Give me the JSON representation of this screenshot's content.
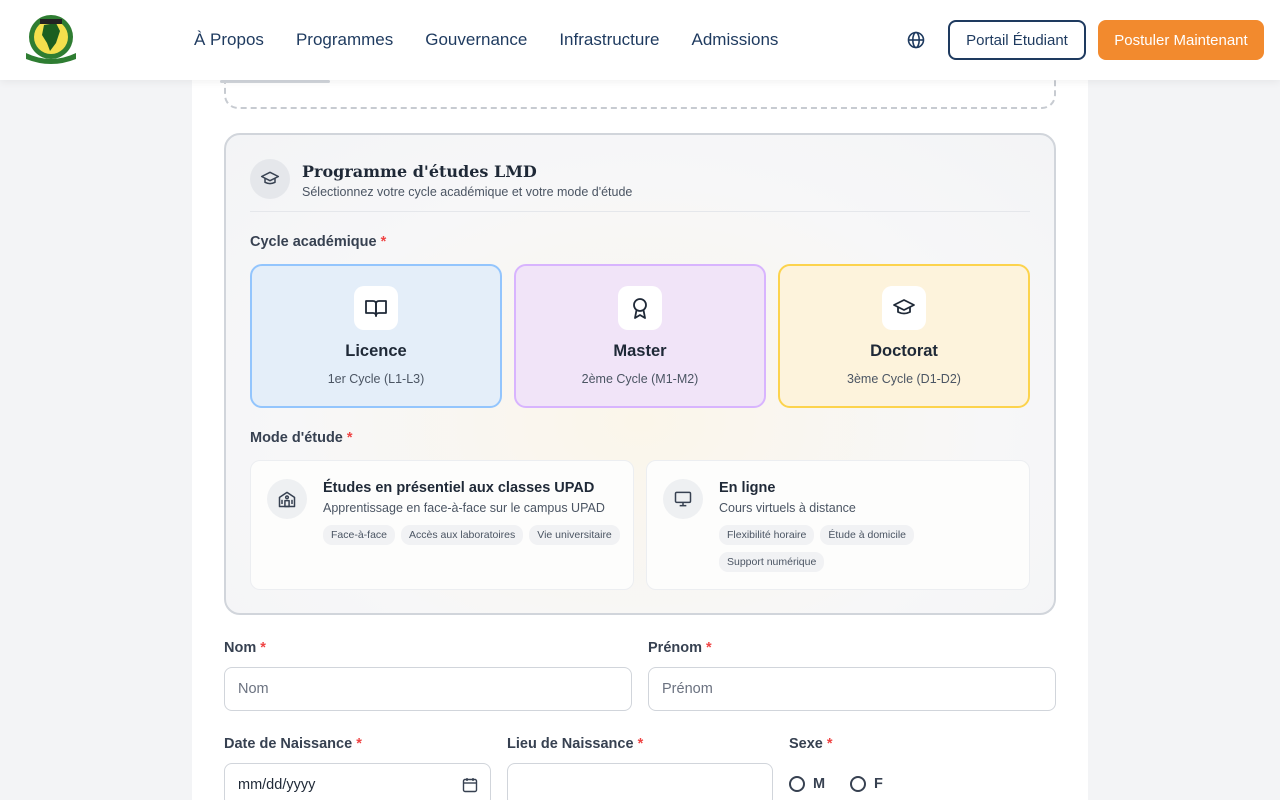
{
  "header": {
    "logo_alt": "UPAD",
    "nav": [
      "À Propos",
      "Programmes",
      "Gouvernance",
      "Infrastructure",
      "Admissions"
    ],
    "language_icon": "globe-icon",
    "portal_label": "Portail Étudiant",
    "apply_label": "Postuler Maintenant",
    "accent_color": "#f28a2e",
    "brand_color": "#1e3a5f"
  },
  "program": {
    "icon": "graduation-cap-icon",
    "title": "Programme d'études LMD",
    "subtitle": "Sélectionnez votre cycle académique et votre mode d'étude",
    "cycle_label": "Cycle académique",
    "required_mark": "*",
    "cycles": [
      {
        "name": "Licence",
        "detail": "1er Cycle (L1-L3)",
        "icon": "book-open-icon"
      },
      {
        "name": "Master",
        "detail": "2ème Cycle (M1-M2)",
        "icon": "award-icon"
      },
      {
        "name": "Doctorat",
        "detail": "3ème Cycle (D1-D2)",
        "icon": "graduation-cap-icon"
      }
    ],
    "mode_label": "Mode d'étude",
    "modes": [
      {
        "name": "Études en présentiel aux classes UPAD",
        "detail": "Apprentissage en face-à-face sur le campus UPAD",
        "icon": "school-building-icon",
        "tags": [
          "Face-à-face",
          "Accès aux laboratoires",
          "Vie universitaire"
        ]
      },
      {
        "name": "En ligne",
        "detail": "Cours virtuels à distance",
        "icon": "monitor-icon",
        "tags": [
          "Flexibilité horaire",
          "Étude à domicile",
          "Support numérique"
        ]
      }
    ]
  },
  "form": {
    "nom_label": "Nom",
    "nom_placeholder": "Nom",
    "prenom_label": "Prénom",
    "prenom_placeholder": "Prénom",
    "dob_label": "Date de Naissance",
    "dob_value": "mm/dd/yyyy",
    "pob_label": "Lieu de Naissance",
    "pob_placeholder": "",
    "sexe_label": "Sexe",
    "sexe_options": [
      "M",
      "F"
    ]
  }
}
